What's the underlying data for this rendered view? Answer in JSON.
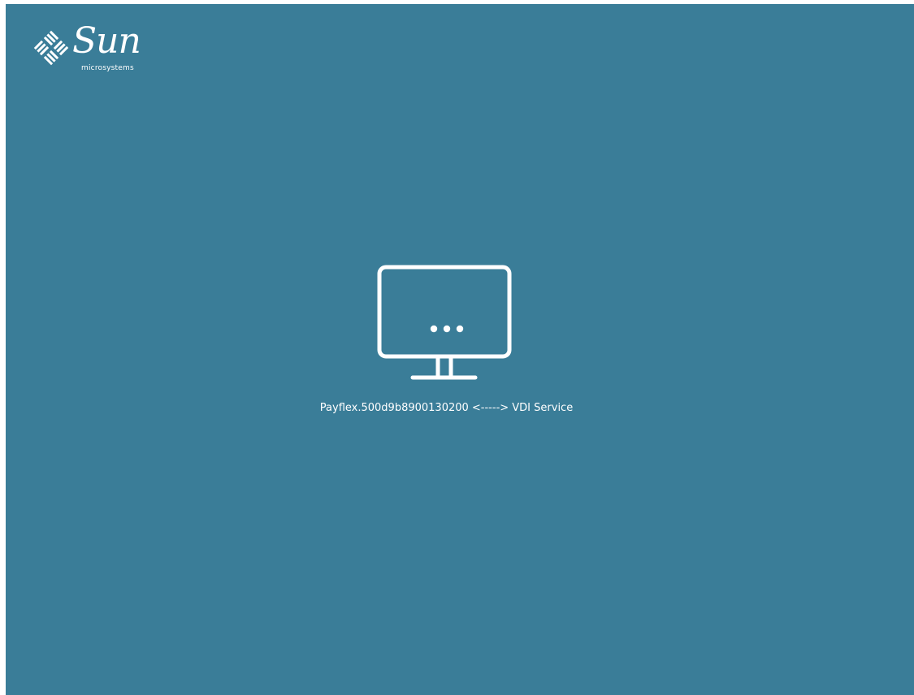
{
  "logo": {
    "brand": "Sun",
    "subtitle": "microsystems",
    "icon": "sun-logo-icon"
  },
  "center": {
    "icon": "monitor-icon",
    "status_text": "Payflex.500d9b8900130200 <-----> VDI Service"
  },
  "colors": {
    "background": "#3a7d98",
    "foreground": "#ffffff"
  }
}
